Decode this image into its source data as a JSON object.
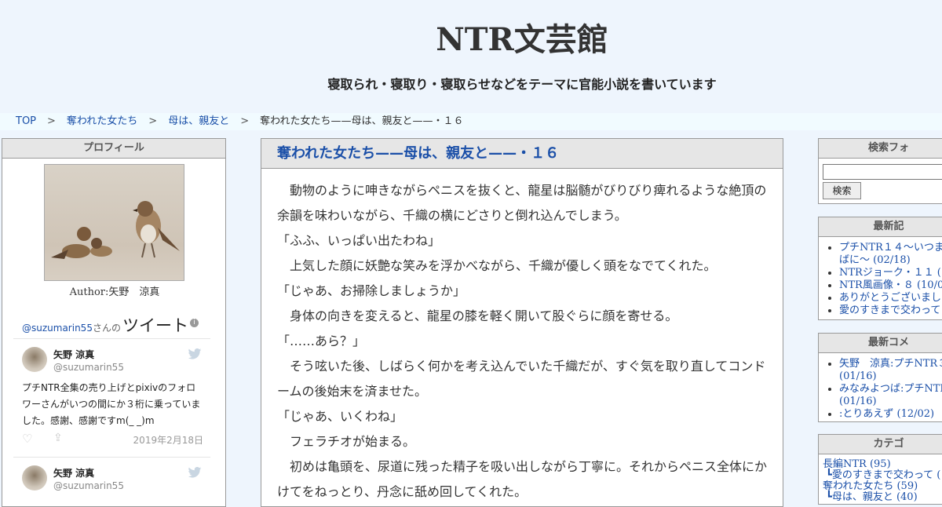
{
  "site": {
    "title": "NTR文芸館",
    "description": "寝取られ・寝取り・寝取らせなどをテーマに官能小説を書いています"
  },
  "breadcrumb": {
    "sep": ">",
    "items": [
      "TOP",
      "奪われた女たち",
      "母は、親友と"
    ],
    "current": "奪われた女たち——母は、親友と——・１６"
  },
  "profile": {
    "heading": "プロフィール",
    "author": "Author:矢野　涼真",
    "twitter_handle_link": "@suzumarin55",
    "twitter_suffix": "さんの",
    "twitter_title": "ツイート",
    "info_glyph": "i",
    "tweets": [
      {
        "name": "矢野 涼真",
        "handle": "@suzumarin55",
        "text": "プチNTR全集の売り上げとpixivのフォロワーさんがいつの間にか３桁に乗っていました。感謝、感謝ですm(_ _)m",
        "date": "2019年2月18日"
      },
      {
        "name": "矢野 涼真",
        "handle": "@suzumarin55"
      }
    ]
  },
  "article": {
    "title": "奪われた女たち——母は、親友と——・１６",
    "paragraphs": [
      "　動物のように呻きながらペニスを抜くと、龍星は脳髄がびりびり痺れるような絶頂の余韻を味わいながら、千織の横にどさりと倒れ込んでしまう。",
      "「ふふ、いっぱい出たわね」",
      "　上気した顔に妖艶な笑みを浮かべながら、千織が優しく頭をなでてくれた。",
      "「じゃあ、お掃除しましょうか」",
      "　身体の向きを変えると、龍星の膝を軽く開いて股ぐらに顔を寄せる。",
      "「……あら？」",
      "　そう呟いた後、しばらく何かを考え込んでいた千織だが、すぐ気を取り直してコンドームの後始末を済ませた。",
      "「じゃあ、いくわね」",
      "　フェラチオが始まる。",
      "　初めは亀頭を、尿道に残った精子を吸い出しながら丁寧に。それからペニス全体にかけてをねっとり、丹念に舐め回してくれた。"
    ]
  },
  "sidebar": {
    "search": {
      "heading": "検索フォ",
      "button": "検索"
    },
    "recent_posts": {
      "heading": "最新記",
      "items": [
        "プチNTR１４～いつま",
        "ばに～ (02/18)",
        "NTRジョーク・１１ (1",
        "NTR風画像・８ (10/01)",
        "ありがとうございまし",
        "愛のすきまで交わって"
      ]
    },
    "recent_comments": {
      "heading": "最新コメ",
      "items": [
        "矢野　涼真:プチNTR３",
        "(01/16)",
        "みなみよつば:プチNTR",
        "(01/16)",
        ":とりあえず (12/02)"
      ]
    },
    "categories": {
      "heading": "カテゴ",
      "items": [
        "長編NTR (95)",
        "┗愛のすきまで交わって (",
        "奪われた女たち (59)",
        "┗母は、親友と (40)"
      ]
    }
  },
  "icons": {
    "heart": "♡",
    "share": "⇪"
  }
}
